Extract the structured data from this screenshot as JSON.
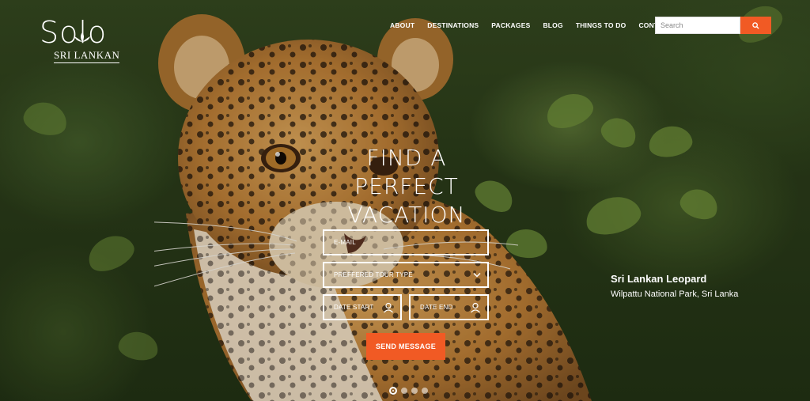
{
  "brand": {
    "name": "Solo",
    "sub": "SRI LANKAN"
  },
  "nav": {
    "items": [
      "ABOUT",
      "DESTINATIONS",
      "PACKAGES",
      "BLOG",
      "THINGS TO DO",
      "CONTACT"
    ]
  },
  "search": {
    "placeholder": "Search",
    "icon": "search-icon"
  },
  "hero": {
    "headline": "FIND A PERFECT VACATION",
    "email_placeholder": "E-MAIL",
    "tour_type_placeholder": "PREFFERED TOUR TYPE",
    "date_start_placeholder": "DATE START",
    "date_end_placeholder": "DATE END",
    "submit_label": "SEND MESSAGE"
  },
  "caption": {
    "title": "Sri Lankan Leopard",
    "location": "Wilpattu National Park, Sri Lanka"
  },
  "slider": {
    "count": 4,
    "active": 1
  },
  "colors": {
    "accent": "#f15a24",
    "text": "#ffffff"
  }
}
